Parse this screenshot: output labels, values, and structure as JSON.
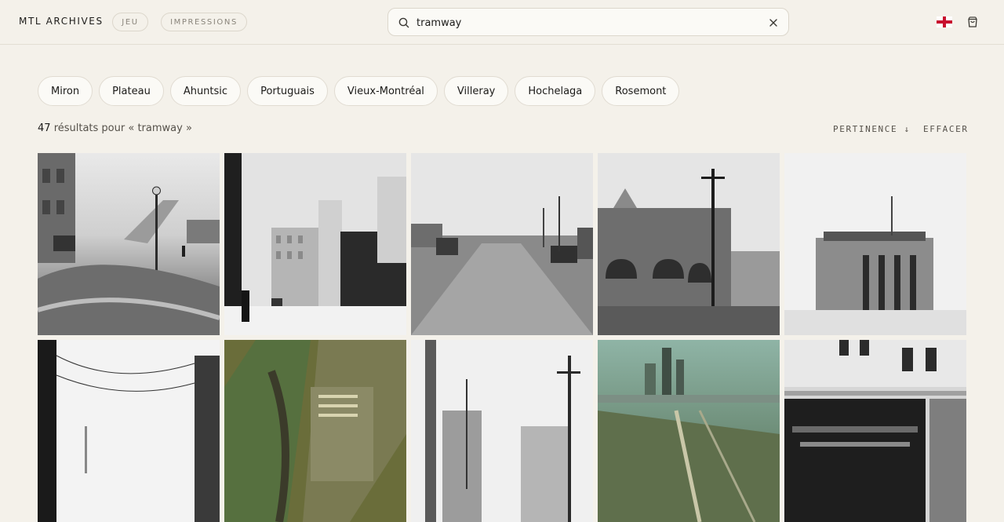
{
  "header": {
    "brand": "MTL ARCHIVES",
    "nav": [
      {
        "label": "JEU"
      },
      {
        "label": "IMPRESSIONS"
      }
    ],
    "search": {
      "value": "tramway",
      "icon": "search-icon",
      "clear_icon": "close-icon"
    },
    "language_icon": "england-flag-icon",
    "cart_icon": "shopping-bag-icon",
    "colors": {
      "flag_red": "#c8102e",
      "accent": "#1c1b19"
    }
  },
  "chips": [
    {
      "label": "Miron"
    },
    {
      "label": "Plateau"
    },
    {
      "label": "Ahuntsic"
    },
    {
      "label": "Portuguais"
    },
    {
      "label": "Vieux-Montréal"
    },
    {
      "label": "Villeray"
    },
    {
      "label": "Hochelaga"
    },
    {
      "label": "Rosemont"
    }
  ],
  "results": {
    "count": "47",
    "text": "résultats pour « tramway »",
    "sort_label": "PERTINENCE ↓",
    "clear_label": "EFFACER"
  },
  "photos": [
    {
      "tone": "bw"
    },
    {
      "tone": "bw"
    },
    {
      "tone": "bw"
    },
    {
      "tone": "bw"
    },
    {
      "tone": "bw"
    },
    {
      "tone": "bw"
    },
    {
      "tone": "color-aerial"
    },
    {
      "tone": "bw"
    },
    {
      "tone": "color-aerial"
    },
    {
      "tone": "bw"
    }
  ]
}
